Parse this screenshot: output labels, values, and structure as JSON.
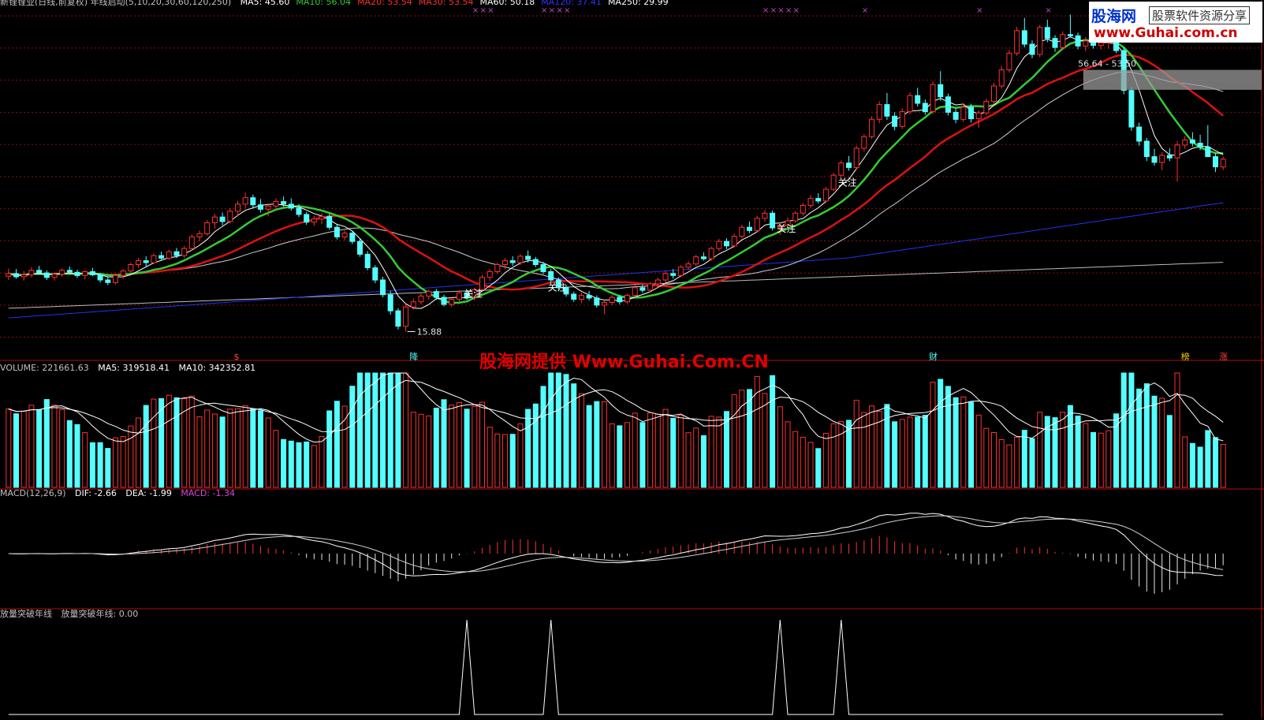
{
  "header": {
    "main": {
      "title": "新锂锂业(日线,前复权) 年线启动(5,10,20,30,60,120,250)",
      "ma": [
        {
          "label": "MA5: 45.60",
          "color": "#ffffff"
        },
        {
          "label": "MA10: 56.04",
          "color": "#33cc33"
        },
        {
          "label": "MA20: 53.54",
          "color": "#ff3030"
        },
        {
          "label": "MA30: 53.54",
          "color": "#ff3030"
        },
        {
          "label": "MA60: 50.18",
          "color": "#ffffff"
        },
        {
          "label": "MA120: 37.41",
          "color": "#3333ff"
        },
        {
          "label": "MA250: 29.99",
          "color": "#ffffff"
        }
      ]
    },
    "volume": {
      "name": "VOLUME: 221661.63",
      "ma5": "MA5: 319518.41",
      "ma10": "MA10: 342352.81"
    },
    "macd": {
      "name": "MACD(12,26,9)",
      "dif": "DIF: -2.66",
      "dea": "DEA: -1.99",
      "macd": "MACD: -1.34"
    },
    "indicator": {
      "name": "放量突破年线",
      "value": "放量突破年线: 0.00"
    }
  },
  "watermark": {
    "logo_top": "股海网",
    "logo_tag": "股票软件资源分享",
    "logo_url": "www.Guhai.com.cn",
    "center": "股海网提供 Www.Guhai.Com.CN"
  },
  "annotations": {
    "low_price": "15.88",
    "range_label": "56.64 - 53.50",
    "attention_label": "关注",
    "event_markers": [
      "$",
      "降",
      "财",
      "榜",
      "涨"
    ]
  },
  "colors": {
    "up": "#ff3030",
    "down": "#54ffff",
    "ma5": "#ffffff",
    "ma10": "#33cc33",
    "ma20": "#dd1111",
    "ma60": "#cccccc",
    "ma120": "#2233ee",
    "ma250": "#bbbbbb",
    "grid": "#8a1010",
    "xmark": "#cc44cc"
  },
  "chart_data": [
    {
      "type": "candlestick",
      "panel": "main",
      "ylim": [
        12,
        66
      ],
      "series_ohlc": [
        [
          24.5,
          25.7,
          23.9,
          24.9
        ],
        [
          24.9,
          25.6,
          24.1,
          24.4
        ],
        [
          24.4,
          25.3,
          23.8,
          24.7
        ],
        [
          24.7,
          25.9,
          24.3,
          25.4
        ],
        [
          25.4,
          26.1,
          24.9,
          25.0
        ],
        [
          25.0,
          25.4,
          23.9,
          24.3
        ],
        [
          24.3,
          25.1,
          23.8,
          24.8
        ],
        [
          24.8,
          25.7,
          24.4,
          25.4
        ],
        [
          25.4,
          26.0,
          24.9,
          25.1
        ],
        [
          25.1,
          25.5,
          24.2,
          24.6
        ],
        [
          24.6,
          25.4,
          24.0,
          25.2
        ],
        [
          25.2,
          25.8,
          24.5,
          24.7
        ],
        [
          24.7,
          25.0,
          23.5,
          23.9
        ],
        [
          23.9,
          24.4,
          23.1,
          23.5
        ],
        [
          23.5,
          24.9,
          23.2,
          24.6
        ],
        [
          24.6,
          25.6,
          24.1,
          25.3
        ],
        [
          25.3,
          26.6,
          25.0,
          26.3
        ],
        [
          26.3,
          27.3,
          25.8,
          26.9
        ],
        [
          26.9,
          27.6,
          26.0,
          26.6
        ],
        [
          26.6,
          28.0,
          26.4,
          27.7
        ],
        [
          27.7,
          28.3,
          26.9,
          27.3
        ],
        [
          27.3,
          28.6,
          27.0,
          28.3
        ],
        [
          28.3,
          28.9,
          27.3,
          27.7
        ],
        [
          27.7,
          29.2,
          27.3,
          28.8
        ],
        [
          28.8,
          31.0,
          28.5,
          30.6
        ],
        [
          30.6,
          31.6,
          29.9,
          31.1
        ],
        [
          31.1,
          33.2,
          30.8,
          32.8
        ],
        [
          32.8,
          34.2,
          31.9,
          33.7
        ],
        [
          33.7,
          34.4,
          32.4,
          33.0
        ],
        [
          33.0,
          35.1,
          32.7,
          34.6
        ],
        [
          34.6,
          36.2,
          33.9,
          35.7
        ],
        [
          35.7,
          37.5,
          35.1,
          36.7
        ],
        [
          36.7,
          37.2,
          35.1,
          35.6
        ],
        [
          35.6,
          36.5,
          34.4,
          34.9
        ],
        [
          34.9,
          35.8,
          33.8,
          35.4
        ],
        [
          35.4,
          36.6,
          34.9,
          36.1
        ],
        [
          36.1,
          36.9,
          35.3,
          35.7
        ],
        [
          35.7,
          36.6,
          34.7,
          35.1
        ],
        [
          35.1,
          35.7,
          33.7,
          34.1
        ],
        [
          34.1,
          34.5,
          32.5,
          32.9
        ],
        [
          32.9,
          33.9,
          32.3,
          33.4
        ],
        [
          33.4,
          34.3,
          32.6,
          33.8
        ],
        [
          33.8,
          34.2,
          31.7,
          32.1
        ],
        [
          32.1,
          32.5,
          30.2,
          30.6
        ],
        [
          30.6,
          31.6,
          30.1,
          31.2
        ],
        [
          31.2,
          31.6,
          29.5,
          29.9
        ],
        [
          29.9,
          30.3,
          27.5,
          27.9
        ],
        [
          27.9,
          28.4,
          25.4,
          25.8
        ],
        [
          25.8,
          26.2,
          23.4,
          23.9
        ],
        [
          23.9,
          24.4,
          21.2,
          21.6
        ],
        [
          21.6,
          22.2,
          18.5,
          19.1
        ],
        [
          19.1,
          19.5,
          16.2,
          16.7
        ],
        [
          16.7,
          20.2,
          15.88,
          19.7
        ],
        [
          19.7,
          21.0,
          19.3,
          20.5
        ],
        [
          20.5,
          21.8,
          20.1,
          21.4
        ],
        [
          21.4,
          22.4,
          20.8,
          22.1
        ],
        [
          22.1,
          22.5,
          20.8,
          21.2
        ],
        [
          21.2,
          21.6,
          19.8,
          20.1
        ],
        [
          20.1,
          21.3,
          19.7,
          20.9
        ],
        [
          20.9,
          22.3,
          20.5,
          21.9
        ],
        [
          21.9,
          22.4,
          20.8,
          21.2
        ],
        [
          21.2,
          22.7,
          20.7,
          22.4
        ],
        [
          22.4,
          24.7,
          22.1,
          24.3
        ],
        [
          24.3,
          25.6,
          23.8,
          25.2
        ],
        [
          25.2,
          26.6,
          24.9,
          26.3
        ],
        [
          26.3,
          27.3,
          25.6,
          26.9
        ],
        [
          26.9,
          27.6,
          26.1,
          26.6
        ],
        [
          26.6,
          27.9,
          26.2,
          27.6
        ],
        [
          27.6,
          28.5,
          26.6,
          27.1
        ],
        [
          27.1,
          27.5,
          25.9,
          26.3
        ],
        [
          26.3,
          26.7,
          24.8,
          25.2
        ],
        [
          25.2,
          25.6,
          23.5,
          23.9
        ],
        [
          23.9,
          24.3,
          22.3,
          22.7
        ],
        [
          22.7,
          23.1,
          21.3,
          21.7
        ],
        [
          21.7,
          22.1,
          20.5,
          20.9
        ],
        [
          20.9,
          21.9,
          20.3,
          21.5
        ],
        [
          21.5,
          22.2,
          20.7,
          21.1
        ],
        [
          21.1,
          21.5,
          19.6,
          20.0
        ],
        [
          20.0,
          20.8,
          18.6,
          20.4
        ],
        [
          20.4,
          21.6,
          20.0,
          21.2
        ],
        [
          21.2,
          21.6,
          20.1,
          20.5
        ],
        [
          20.5,
          21.8,
          20.2,
          21.5
        ],
        [
          21.5,
          23.1,
          21.2,
          22.7
        ],
        [
          22.7,
          23.2,
          21.9,
          22.3
        ],
        [
          22.3,
          23.6,
          22.0,
          23.3
        ],
        [
          23.3,
          24.3,
          22.8,
          23.9
        ],
        [
          23.9,
          25.3,
          23.5,
          24.9
        ],
        [
          24.9,
          25.6,
          24.1,
          24.6
        ],
        [
          24.6,
          26.2,
          24.3,
          25.9
        ],
        [
          25.9,
          26.8,
          25.5,
          26.4
        ],
        [
          26.4,
          27.8,
          26.1,
          27.5
        ],
        [
          27.5,
          28.2,
          26.9,
          27.2
        ],
        [
          27.2,
          29.1,
          26.9,
          28.8
        ],
        [
          28.8,
          30.3,
          28.4,
          29.9
        ],
        [
          29.9,
          30.4,
          28.7,
          29.2
        ],
        [
          29.2,
          31.1,
          28.9,
          30.7
        ],
        [
          30.7,
          32.5,
          30.4,
          32.1
        ],
        [
          32.1,
          33.0,
          31.2,
          31.6
        ],
        [
          31.6,
          33.9,
          31.3,
          33.5
        ],
        [
          33.5,
          34.8,
          33.0,
          34.3
        ],
        [
          34.3,
          34.7,
          31.6,
          32.0
        ],
        [
          32.0,
          32.8,
          30.9,
          32.4
        ],
        [
          32.4,
          33.6,
          31.9,
          33.1
        ],
        [
          33.1,
          34.6,
          32.8,
          34.3
        ],
        [
          34.3,
          35.9,
          33.9,
          35.5
        ],
        [
          35.5,
          37.1,
          35.1,
          36.6
        ],
        [
          36.6,
          37.4,
          35.8,
          36.2
        ],
        [
          36.2,
          38.4,
          35.9,
          38.0
        ],
        [
          38.0,
          40.6,
          37.7,
          40.2
        ],
        [
          40.2,
          42.5,
          39.8,
          42.1
        ],
        [
          42.1,
          43.2,
          40.9,
          41.4
        ],
        [
          41.4,
          44.8,
          41.1,
          44.4
        ],
        [
          44.4,
          46.6,
          43.9,
          46.2
        ],
        [
          46.2,
          49.4,
          45.9,
          48.9
        ],
        [
          48.9,
          51.7,
          48.3,
          51.2
        ],
        [
          51.2,
          53.0,
          48.8,
          49.4
        ],
        [
          49.4,
          50.0,
          47.2,
          47.8
        ],
        [
          47.8,
          50.6,
          47.4,
          50.1
        ],
        [
          50.1,
          53.1,
          49.7,
          52.6
        ],
        [
          52.6,
          53.8,
          50.9,
          51.4
        ],
        [
          51.4,
          52.0,
          49.6,
          50.1
        ],
        [
          50.1,
          54.8,
          49.7,
          54.3
        ],
        [
          54.3,
          56.4,
          51.8,
          52.4
        ],
        [
          52.4,
          52.9,
          49.5,
          50.0
        ],
        [
          50.0,
          50.6,
          48.3,
          48.9
        ],
        [
          48.9,
          51.3,
          48.5,
          50.8
        ],
        [
          50.8,
          51.3,
          48.4,
          49.0
        ],
        [
          49.0,
          50.3,
          47.6,
          49.9
        ],
        [
          49.9,
          52.1,
          49.5,
          51.7
        ],
        [
          51.7,
          54.6,
          51.3,
          54.1
        ],
        [
          54.1,
          57.2,
          53.7,
          56.6
        ],
        [
          56.6,
          59.7,
          56.2,
          59.2
        ],
        [
          59.2,
          63.3,
          58.8,
          62.7
        ],
        [
          62.7,
          64.7,
          60.1,
          60.6
        ],
        [
          60.6,
          61.2,
          58.4,
          59.0
        ],
        [
          59.0,
          63.6,
          58.6,
          63.2
        ],
        [
          63.2,
          64.4,
          60.9,
          61.5
        ],
        [
          61.5,
          62.0,
          59.4,
          60.1
        ],
        [
          60.1,
          62.6,
          59.7,
          62.1
        ],
        [
          62.1,
          65.2,
          61.6,
          61.9
        ],
        [
          61.9,
          62.4,
          59.8,
          60.3
        ],
        [
          60.3,
          61.7,
          59.5,
          61.1
        ],
        [
          61.1,
          61.5,
          59.9,
          60.4
        ],
        [
          60.4,
          61.6,
          59.8,
          60.8
        ],
        [
          60.8,
          62.0,
          59.9,
          61.3
        ],
        [
          61.3,
          62.8,
          59.2,
          59.6
        ],
        [
          59.6,
          60.1,
          52.8,
          53.4
        ],
        [
          53.4,
          53.9,
          47.1,
          47.7
        ],
        [
          47.7,
          48.4,
          44.8,
          45.5
        ],
        [
          45.5,
          46.0,
          42.4,
          43.1
        ],
        [
          43.1,
          44.3,
          41.7,
          42.2
        ],
        [
          42.2,
          43.8,
          41.0,
          43.3
        ],
        [
          43.3,
          44.4,
          42.4,
          42.9
        ],
        [
          42.9,
          45.5,
          39.2,
          44.9
        ],
        [
          44.9,
          46.3,
          44.3,
          45.7
        ],
        [
          45.7,
          46.9,
          44.7,
          45.2
        ],
        [
          45.2,
          46.5,
          44.1,
          44.6
        ],
        [
          44.6,
          48.0,
          44.2,
          43.1
        ],
        [
          43.1,
          43.7,
          40.7,
          41.5
        ],
        [
          41.5,
          43.1,
          41.0,
          42.7
        ]
      ]
    },
    {
      "type": "bar",
      "panel": "volume",
      "name": "VOLUME",
      "ylim": [
        0,
        460000
      ]
    },
    {
      "type": "line",
      "panel": "macd",
      "series": [
        {
          "name": "DIF"
        },
        {
          "name": "DEA"
        },
        {
          "name": "MACD"
        }
      ]
    },
    {
      "type": "line",
      "panel": "indicator",
      "name": "放量突破年线",
      "ylim": [
        0,
        1
      ],
      "signal_index": [
        60,
        71,
        101,
        109
      ]
    }
  ]
}
